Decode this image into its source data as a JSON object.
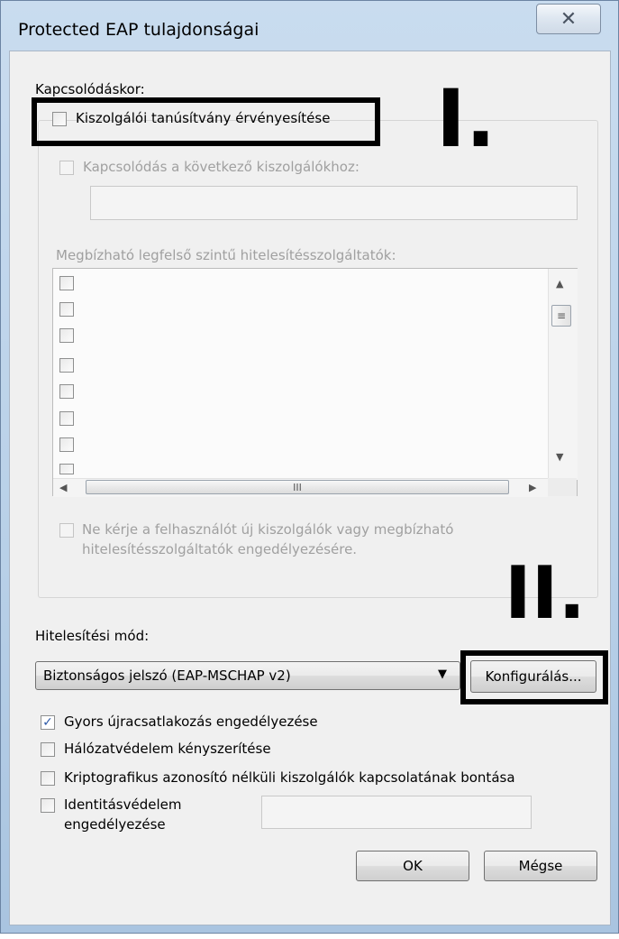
{
  "window": {
    "title": "Protected EAP tulajdonságai",
    "close_glyph": "✕"
  },
  "connect": {
    "section_label": "Kapcsolódáskor:",
    "validate_cert_label": "Kiszolgálói tanúsítvány érvényesítése",
    "validate_cert_checked": false,
    "connect_servers_label": "Kapcsolódás a következő kiszolgálókhoz:",
    "connect_servers_value": "",
    "trusted_ca_label": "Megbízható legfelső szintű hitelesítésszolgáltatók:",
    "trusted_ca_row_count": 8,
    "scroll_thumb_glyph": "≡",
    "hscroll_thumb_glyph": "III",
    "no_prompt_line1": "Ne kérje a felhasználót új kiszolgálók vagy megbízható",
    "no_prompt_line2": "hitelesítésszolgáltatók engedélyezésére."
  },
  "auth": {
    "method_label": "Hitelesítési mód:",
    "method_selected": "Biztonságos jelszó (EAP-MSCHAP v2)",
    "configure_label": "Konfigurálás..."
  },
  "options": {
    "fast_reconnect_label": "Gyors újracsatlakozás engedélyezése",
    "fast_reconnect_checked": true,
    "nap_label": "Hálózatvédelem kényszerítése",
    "nap_checked": false,
    "cryptobinding_label": "Kriptografikus azonosító nélküli kiszolgálók kapcsolatának bontása",
    "cryptobinding_checked": false,
    "identity_privacy_line1": "Identitásvédelem",
    "identity_privacy_line2": "engedélyezése",
    "identity_privacy_checked": false,
    "identity_value": ""
  },
  "buttons": {
    "ok": "OK",
    "cancel": "Mégse"
  },
  "annotations": {
    "marker_one": "I.",
    "marker_two": "II."
  }
}
